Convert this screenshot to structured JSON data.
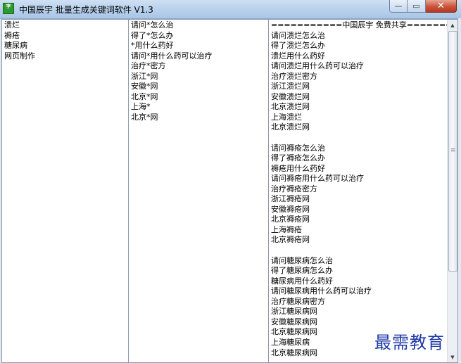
{
  "window": {
    "icon_text": "字",
    "title": "中国辰宇 批量生成关键词软件 V1.3",
    "buttons": {
      "minimize": "—",
      "maximize": "▭",
      "close": "✕"
    }
  },
  "keywords_pane": {
    "lines": [
      "溃烂",
      "褥疮",
      "糖尿病",
      "网页制作"
    ]
  },
  "templates_pane": {
    "lines": [
      "请问*怎么治",
      "得了*怎么办",
      "*用什么药好",
      "请问*用什么药可以治疗",
      "治疗*密方",
      "浙江*网",
      "安徽*网",
      "北京*网",
      "上海*",
      "北京*网"
    ]
  },
  "output_pane": {
    "lines": [
      "===========中国辰宇 免费共享================",
      "请问溃烂怎么治",
      "得了溃烂怎么办",
      "溃烂用什么药好",
      "请问溃烂用什么药可以治疗",
      "治疗溃烂密方",
      "浙江溃烂网",
      "安徽溃烂网",
      "北京溃烂网",
      "上海溃烂",
      "北京溃烂网",
      "",
      "请问褥疮怎么治",
      "得了褥疮怎么办",
      "褥疮用什么药好",
      "请问褥疮用什么药可以治疗",
      "治疗褥疮密方",
      "浙江褥疮网",
      "安徽褥疮网",
      "北京褥疮网",
      "上海褥疮",
      "北京褥疮网",
      "",
      "请问糖尿病怎么治",
      "得了糖尿病怎么办",
      "糖尿病用什么药好",
      "请问糖尿病用什么药可以治疗",
      "治疗糖尿病密方",
      "浙江糖尿病网",
      "安徽糖尿病网",
      "北京糖尿病网",
      "上海糖尿病",
      "北京糖尿病网"
    ],
    "scrollbar": {
      "up_icon": "▲",
      "down_icon": "▼",
      "grip_icon": "≡"
    }
  },
  "watermark": "最需教育"
}
